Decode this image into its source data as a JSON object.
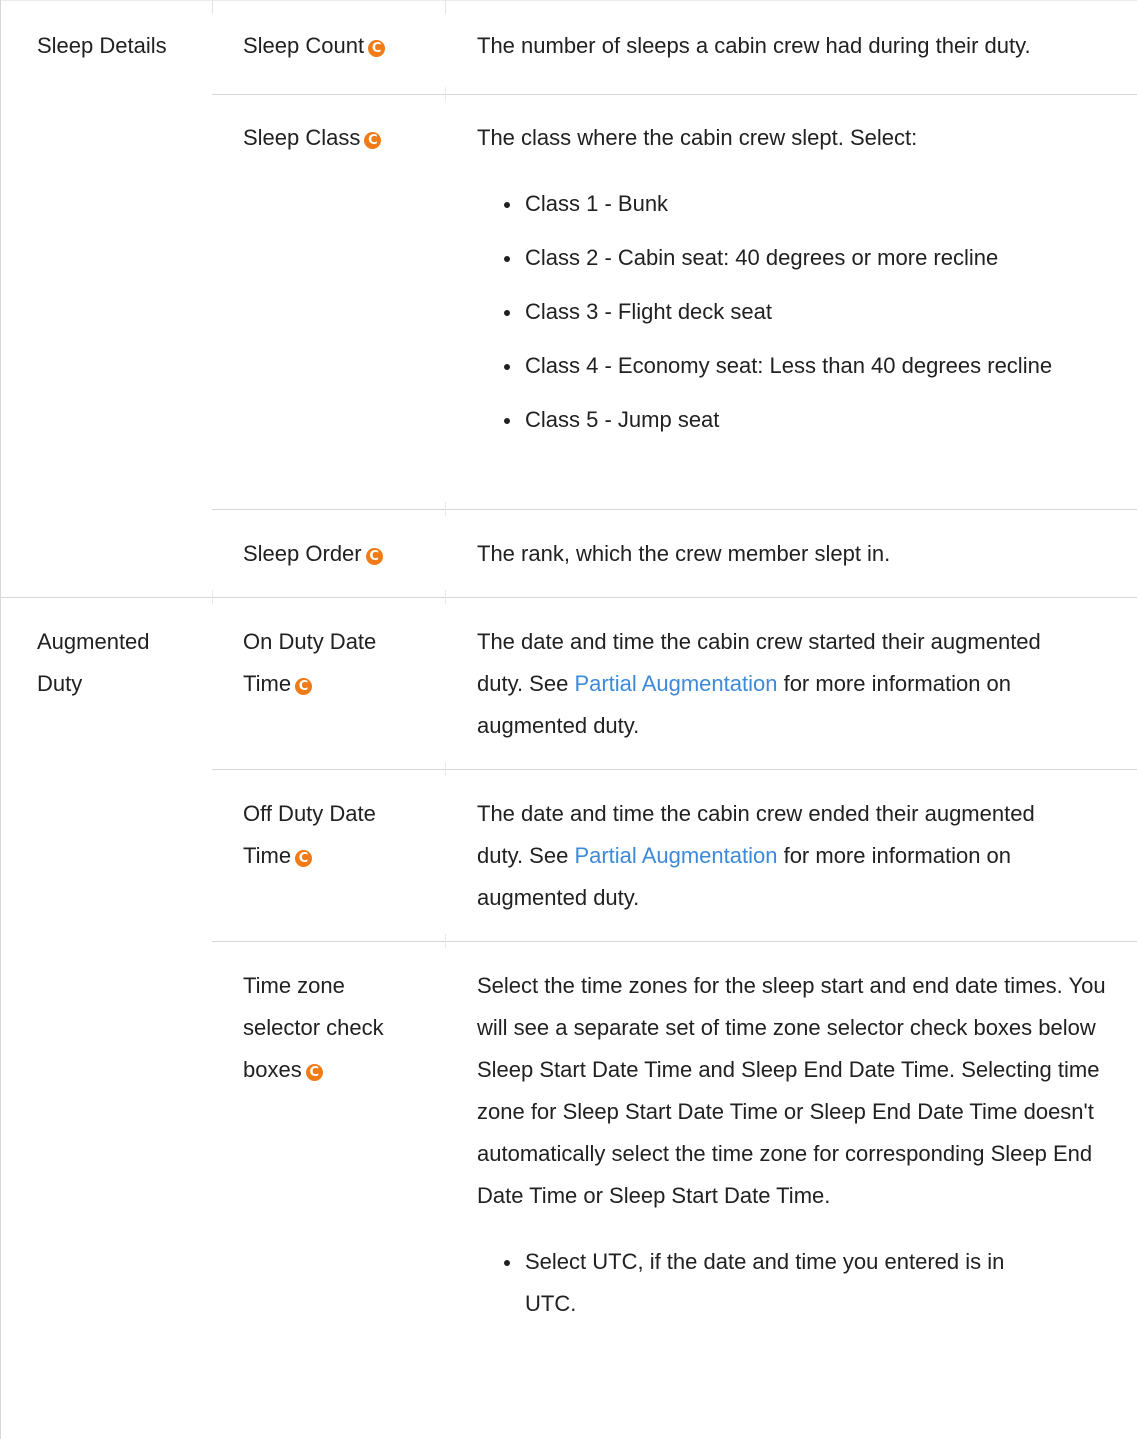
{
  "groups": [
    {
      "label": "Sleep Details",
      "rows": [
        {
          "field": "Sleep Count",
          "description": "The number of sleeps a cabin crew had during their duty."
        },
        {
          "field": "Sleep Class",
          "description": "The class where the cabin crew slept. Select:",
          "options": [
            "Class 1 - Bunk",
            "Class 2 - Cabin seat: 40 degrees or more recline",
            "Class 3 - Flight deck seat",
            "Class 4 - Economy seat: Less than 40 degrees recline",
            "Class 5 - Jump seat"
          ]
        },
        {
          "field": "Sleep Order",
          "description": "The rank, which the crew member slept in."
        }
      ]
    },
    {
      "label": "Augmented Duty",
      "rows": [
        {
          "field": "On Duty Date Time",
          "desc_before": "The date and time the cabin crew started their augmented duty. See ",
          "link": "Partial Augmentation",
          "desc_after": " for more information on augmented duty."
        },
        {
          "field": "Off Duty Date Time",
          "desc_before": "The date and time the cabin crew ended their augmented duty. See ",
          "link": "Partial Augmentation",
          "desc_after": " for more information on augmented duty."
        },
        {
          "field": "Time zone selector check boxes",
          "description": "Select the time zones for the sleep start and end date times. You will see a separate set of time zone selector check boxes below Sleep Start Date Time and Sleep End Date Time. Selecting time zone for Sleep Start Date Time or Sleep End Date Time doesn't automatically select the time zone for corresponding Sleep End Date Time or Sleep Start Date Time.",
          "options": [
            "Select UTC, if the date and time you entered is in UTC."
          ]
        }
      ]
    }
  ],
  "badge_glyph": "C",
  "colors": {
    "badge": "#f07b17",
    "link": "#3d8ad8",
    "rule": "#d7d7d7",
    "text": "#212121"
  }
}
